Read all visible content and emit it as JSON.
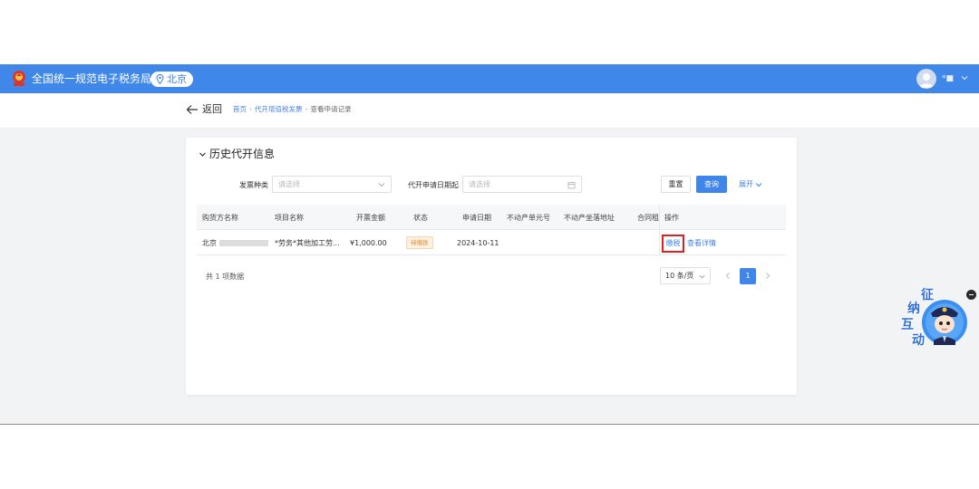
{
  "header": {
    "site_title": "全国统一规范电子税务局",
    "region": "北京",
    "user_name": "*■",
    "colors": {
      "bar": "#4087ea",
      "accent": "#3f85ea"
    }
  },
  "nav": {
    "back_label": "返回",
    "breadcrumb": [
      "首页",
      "代开增值税发票",
      "查看申请记录"
    ]
  },
  "section": {
    "title": "历史代开信息"
  },
  "filters": {
    "invoice_type": {
      "label": "发票种类",
      "placeholder": "请选择"
    },
    "apply_date": {
      "label": "代开申请日期起",
      "placeholder": "请选择"
    },
    "reset_label": "重置",
    "query_label": "查询",
    "expand_label": "展开"
  },
  "table": {
    "columns": [
      "购货方名称",
      "项目名称",
      "开票金额",
      "状态",
      "申请日期",
      "不动产单元号",
      "不动产坐落地址",
      "合同租赁",
      "操作"
    ],
    "rows": [
      {
        "buyer": "北京",
        "item": "*劳务*其他加工劳...",
        "amount": "¥1,000.00",
        "status": "待缴款",
        "date": "2024-10-11",
        "unit_no": "",
        "address": "",
        "actions": [
          "缴税",
          "查看详情"
        ]
      }
    ]
  },
  "pagination": {
    "total_text": "共 1 项数据",
    "page_size": "10 条/页",
    "current_page": "1"
  },
  "mascot": {
    "chars": [
      "征",
      "纳",
      "互",
      "动"
    ]
  }
}
